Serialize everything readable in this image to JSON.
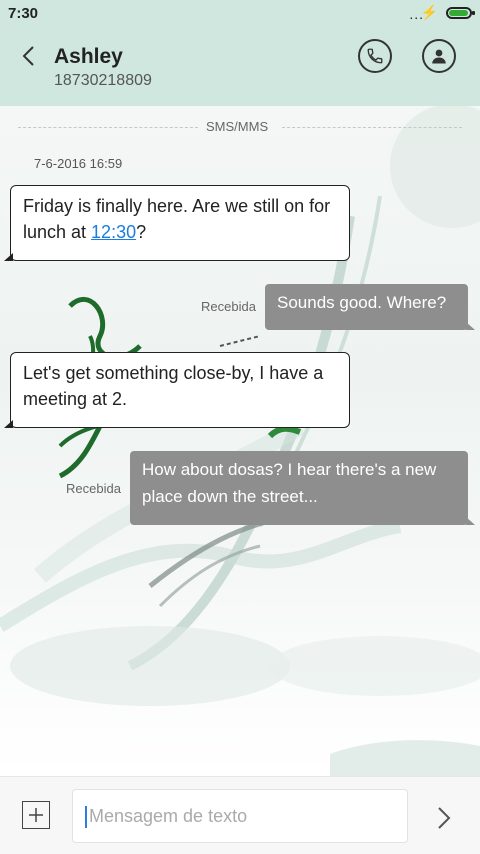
{
  "status_bar": {
    "time": "7:30",
    "dots": "...",
    "bolt": "⚡"
  },
  "header": {
    "contact_name": "Ashley",
    "contact_number": "18730218809"
  },
  "conversation": {
    "separator_label": "SMS/MMS",
    "date": "7-6-2016 16:59",
    "messages": [
      {
        "direction": "incoming",
        "text_before_link": "Friday is finally here. Are we still on for lunch at ",
        "link": "12:30",
        "text_after_link": "?"
      },
      {
        "direction": "outgoing",
        "status": "Recebida",
        "text": "Sounds good. Where?"
      },
      {
        "direction": "incoming",
        "text": "Let's get something close-by, I have a meeting at 2."
      },
      {
        "direction": "outgoing",
        "status": "Recebida",
        "text": "How about dosas? I hear there's a new place down the street..."
      }
    ]
  },
  "input_bar": {
    "placeholder": "Mensagem de texto"
  },
  "colors": {
    "header_bg": "#cfe7de",
    "outgoing_bubble": "#8e8e8e",
    "link": "#1a7de0"
  }
}
